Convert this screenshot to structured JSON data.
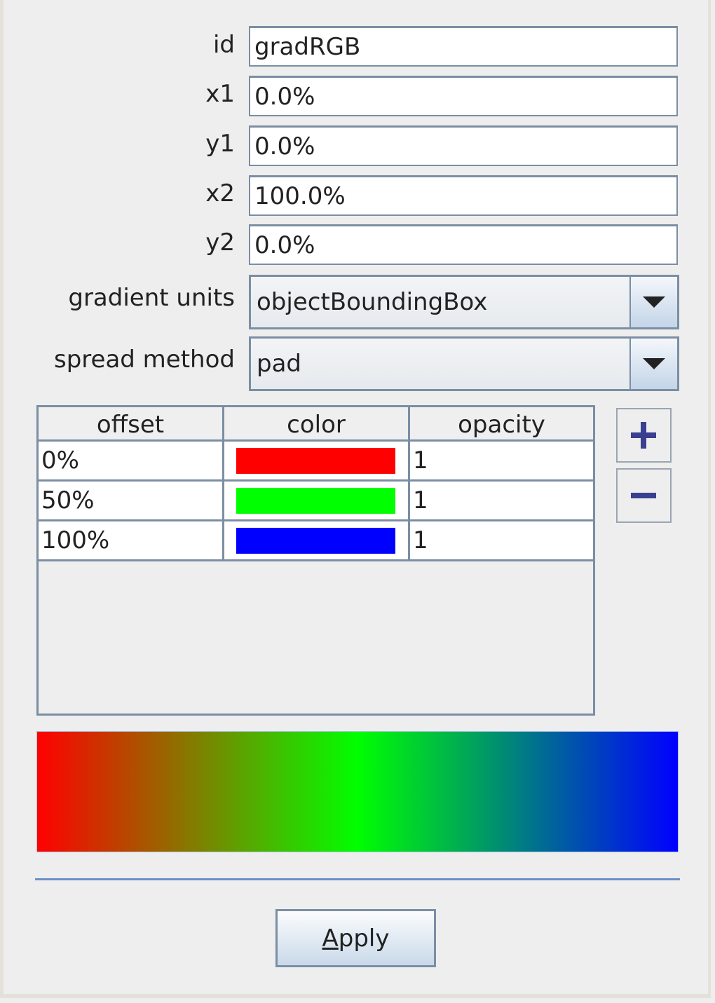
{
  "fields": [
    {
      "label": "id",
      "value": "gradRGB"
    },
    {
      "label": "x1",
      "value": "0.0%"
    },
    {
      "label": "y1",
      "value": "0.0%"
    },
    {
      "label": "x2",
      "value": "100.0%"
    },
    {
      "label": "y2",
      "value": "0.0%"
    }
  ],
  "gradient_units": {
    "label": "gradient units",
    "value": "objectBoundingBox"
  },
  "spread_method": {
    "label": "spread method",
    "value": "pad"
  },
  "stops_table": {
    "headers": [
      "offset",
      "color",
      "opacity"
    ],
    "rows": [
      {
        "offset": "0%",
        "color": "#ff0000",
        "opacity": "1"
      },
      {
        "offset": "50%",
        "color": "#00ff00",
        "opacity": "1"
      },
      {
        "offset": "100%",
        "color": "#0000ff",
        "opacity": "1"
      }
    ]
  },
  "buttons": {
    "add_icon": "plus-icon",
    "remove_icon": "minus-icon",
    "apply_mnemonic": "A",
    "apply_rest": "pply"
  },
  "colors": {
    "accent": "#6d8fc9",
    "border": "#7b8ea3",
    "icon": "#3a3f8f"
  }
}
